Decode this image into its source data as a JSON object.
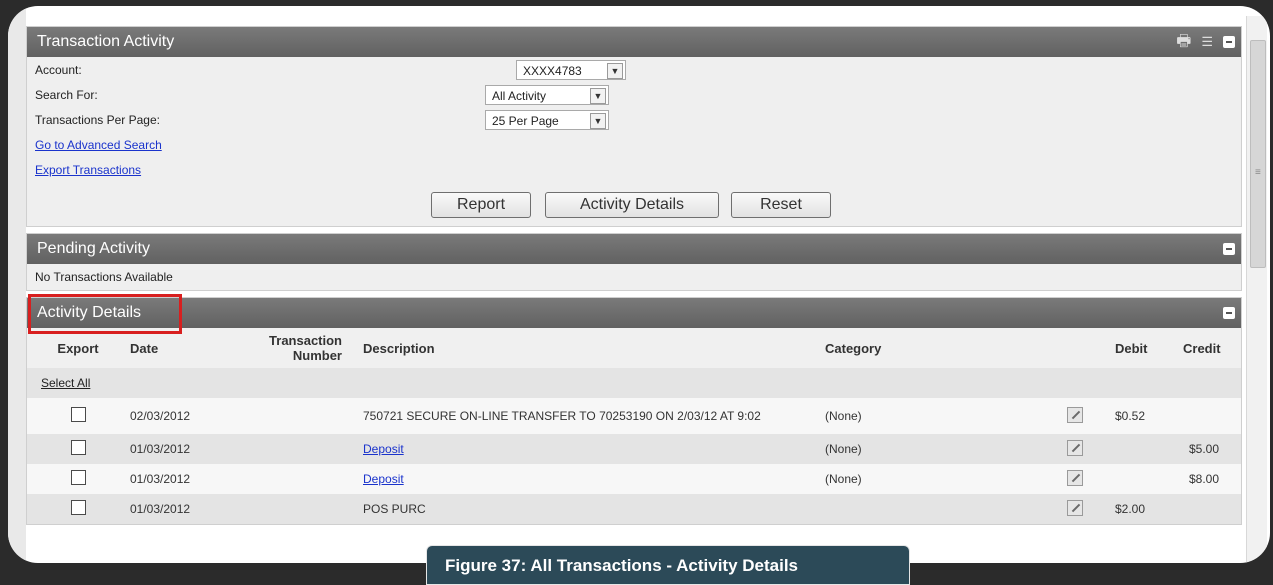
{
  "transaction_panel": {
    "title": "Transaction Activity",
    "account_label": "Account:",
    "account_value": "XXXX4783",
    "search_label": "Search For:",
    "search_value": "All Activity",
    "per_page_label": "Transactions Per Page:",
    "per_page_value": "25 Per Page",
    "advanced_link": "Go to Advanced Search",
    "export_link": "Export Transactions",
    "buttons": [
      "Report",
      "Activity Details",
      "Reset"
    ]
  },
  "pending_panel": {
    "title": "Pending Activity",
    "message": "No Transactions Available"
  },
  "activity_panel": {
    "title": "Activity Details",
    "columns": [
      "Export",
      "Date",
      "Transaction Number",
      "Description",
      "Category",
      "Debit",
      "Credit"
    ],
    "select_all": "Select All",
    "rows": [
      {
        "date": "02/03/2012",
        "description": "750721 SECURE ON-LINE TRANSFER TO 70253190 ON 2/03/12 AT 9:02",
        "category": "(None)",
        "debit": "$0.52",
        "credit": ""
      },
      {
        "date": "01/03/2012",
        "description": "Deposit",
        "category": "(None)",
        "debit": "",
        "credit": "$5.00"
      },
      {
        "date": "01/03/2012",
        "description": "Deposit",
        "category": "(None)",
        "debit": "",
        "credit": "$8.00"
      },
      {
        "date": "01/03/2012",
        "description": "POS PURC",
        "category": "",
        "debit": "$2.00",
        "credit": ""
      }
    ]
  },
  "caption": "Figure 37: All Transactions - Activity Details",
  "colors": {
    "header_bg": "#6b6b6b",
    "highlight": "#d81f1f",
    "caption_bg": "#2c4a58"
  }
}
